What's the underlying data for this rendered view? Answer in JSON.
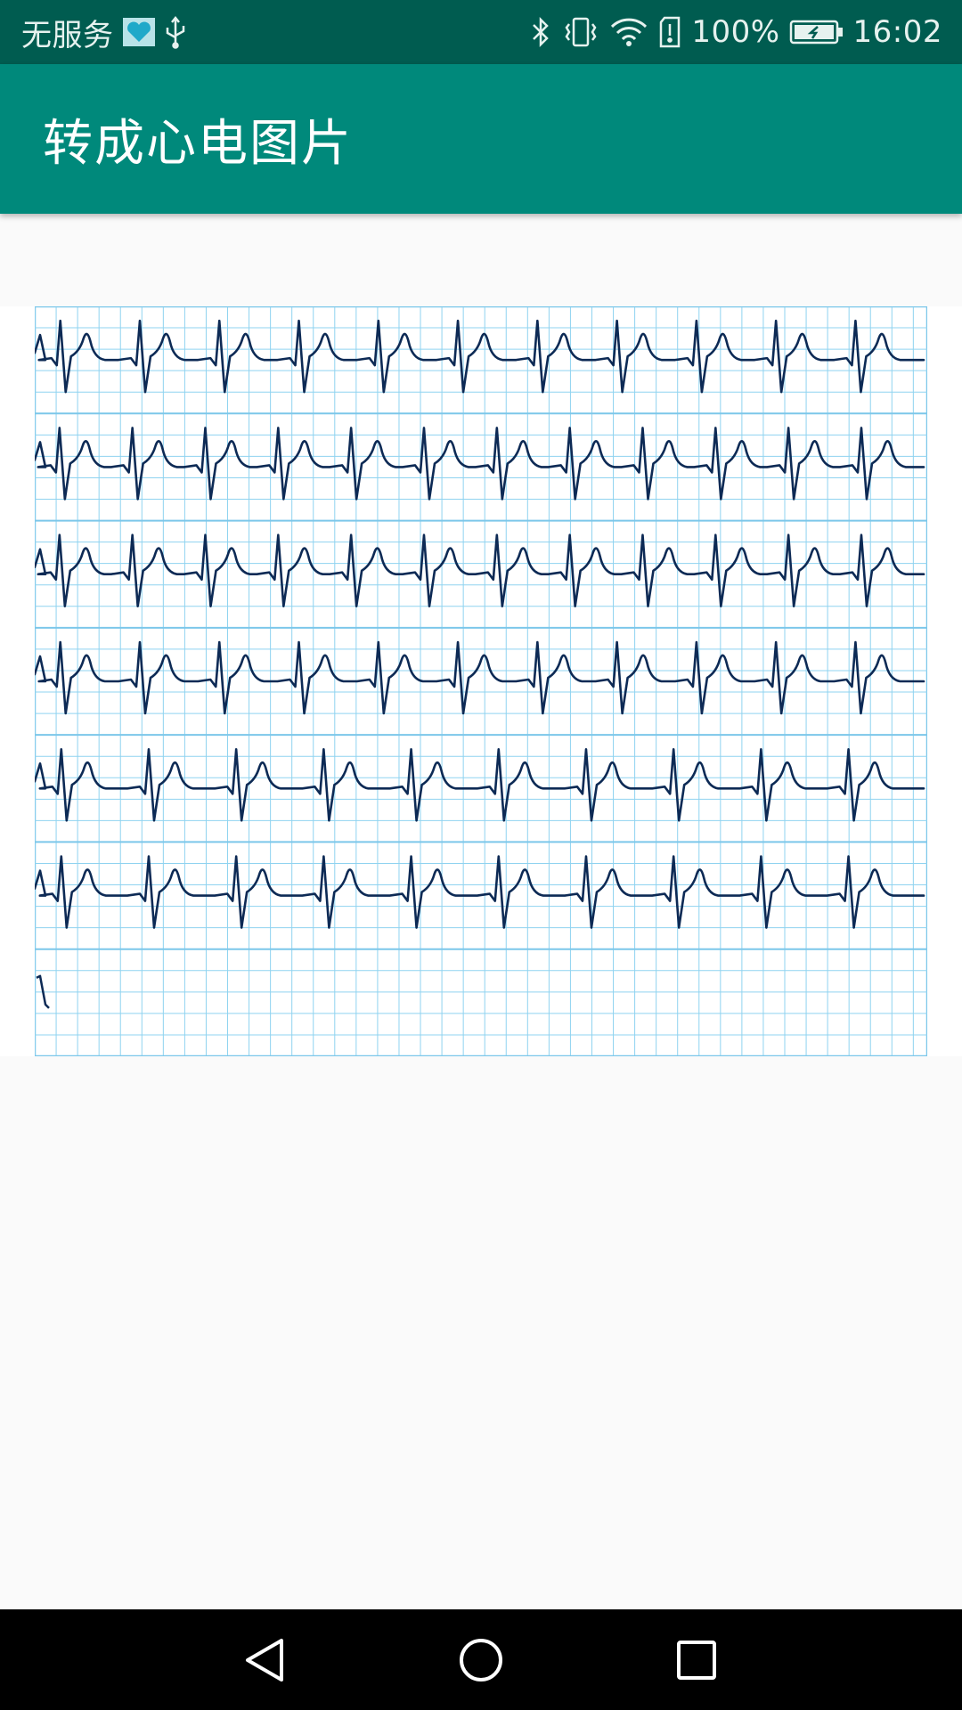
{
  "status_bar": {
    "carrier": "无服务",
    "battery": "100%",
    "time": "16:02",
    "icons": [
      "health-app-icon",
      "usb-icon",
      "bluetooth-icon",
      "vibrate-icon",
      "wifi-icon",
      "sim-alert-icon",
      "battery-charging-icon"
    ]
  },
  "app_bar": {
    "title": "转成心电图片"
  },
  "ecg": {
    "rows": 7,
    "beats_per_row": [
      11,
      12,
      12,
      11,
      10,
      10,
      0
    ],
    "grid_color": "#8fd3f0",
    "major_grid_color": "#7cc7ea",
    "trace_color": "#0d2a55"
  },
  "nav_bar": {
    "buttons": [
      "back-icon",
      "home-icon",
      "recents-icon"
    ]
  },
  "colors": {
    "status_bar": "#005c50",
    "app_bar": "#00897b",
    "nav_bar": "#000000",
    "background": "#fafafa"
  }
}
